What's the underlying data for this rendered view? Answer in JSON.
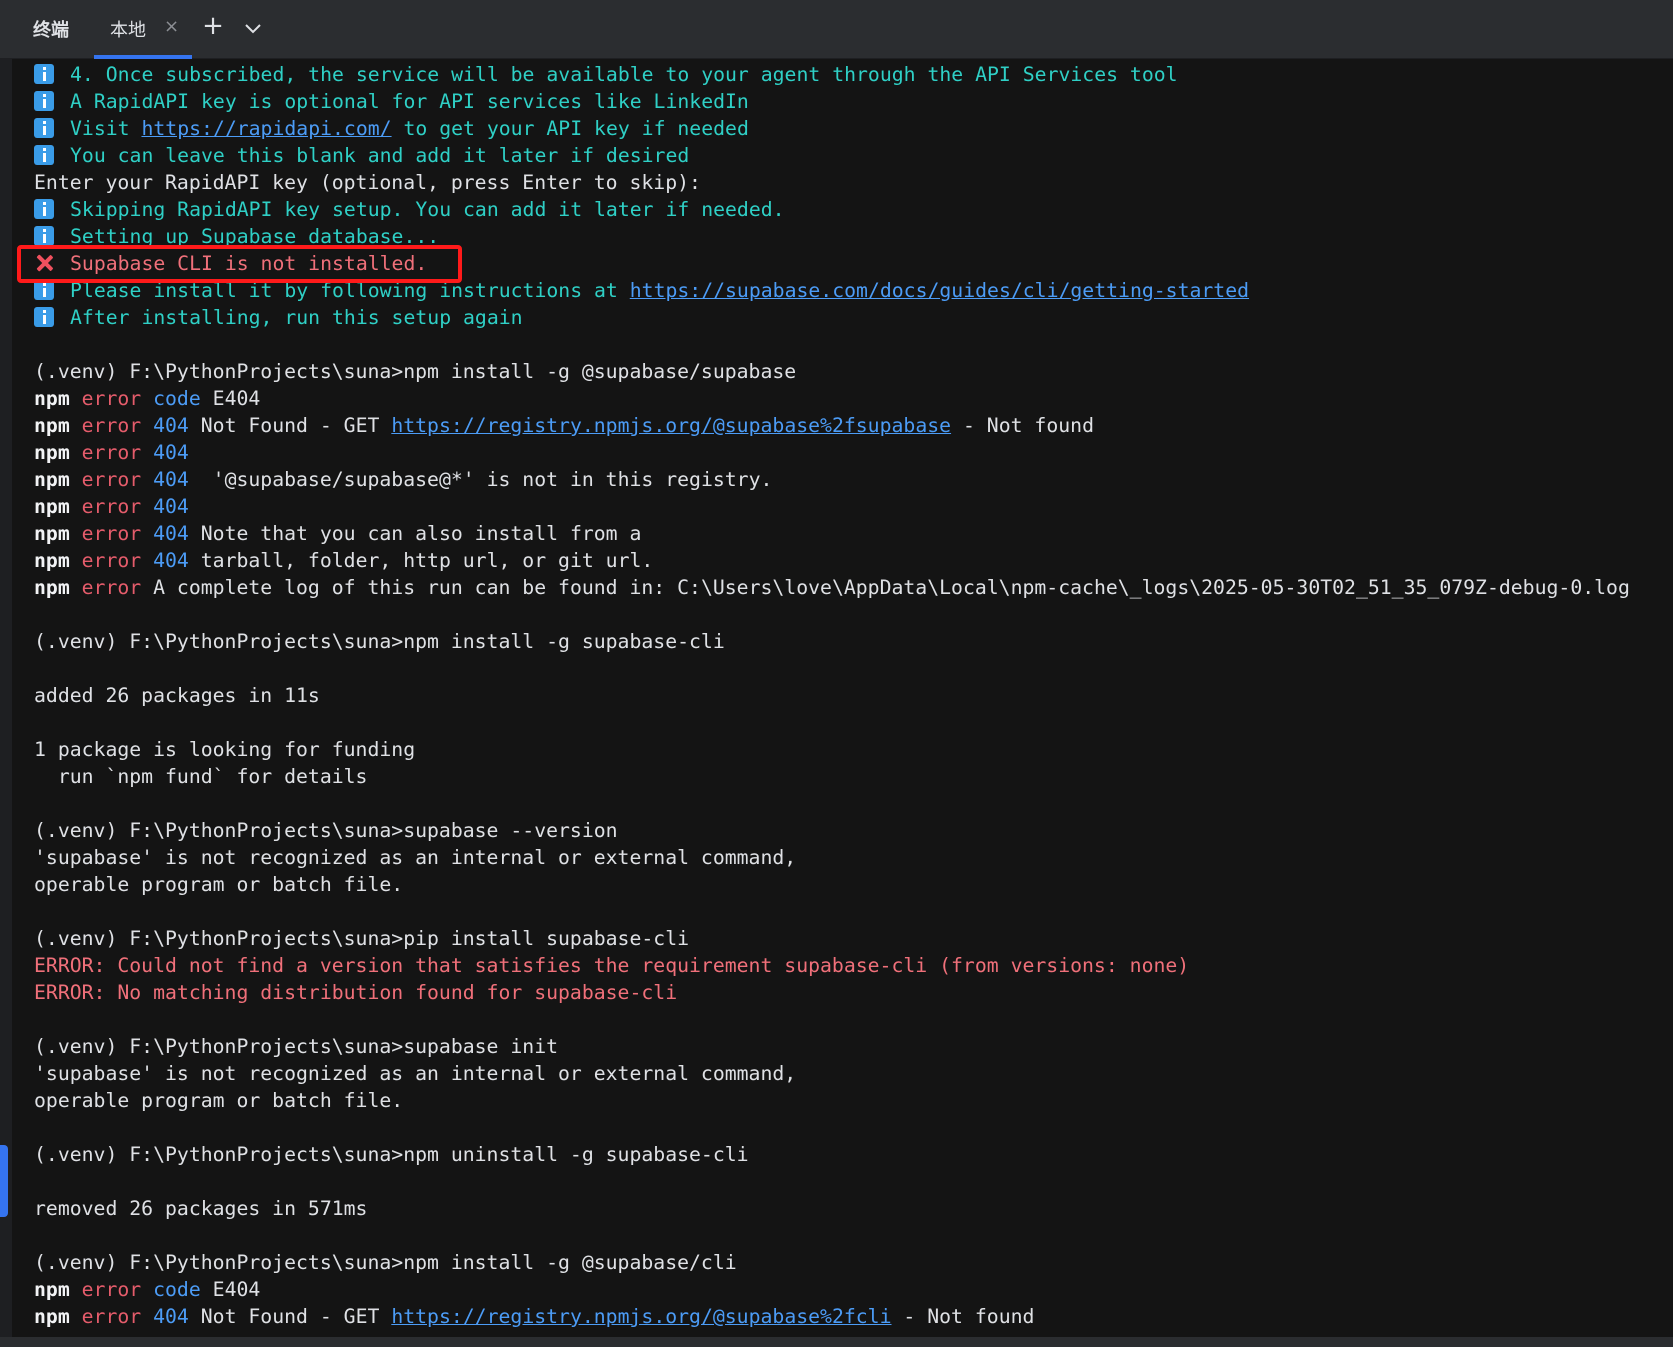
{
  "window": {
    "tool_title": "终端",
    "tab_label": "本地",
    "tab_close": "×",
    "new_tab": "+"
  },
  "colors": {
    "background": "#141414",
    "tab_bar": "#2b2d30",
    "accent": "#3574f0",
    "info_text": "#2fd0c6",
    "error_text": "#f0707a",
    "link": "#4c9cf6",
    "highlight_box": "#ff1a1a"
  },
  "terminal": {
    "lines": [
      {
        "icon": "info",
        "segments": [
          {
            "t": "4. Once subscribed, the service will be available to your agent through the API Services tool",
            "c": "info"
          }
        ]
      },
      {
        "icon": "info",
        "segments": [
          {
            "t": "A RapidAPI key is optional for API services like LinkedIn",
            "c": "info"
          }
        ]
      },
      {
        "icon": "info",
        "segments": [
          {
            "t": "Visit ",
            "c": "info"
          },
          {
            "t": "https://rapidapi.com/",
            "c": "link"
          },
          {
            "t": " to get your API key if needed",
            "c": "info"
          }
        ]
      },
      {
        "icon": "info",
        "segments": [
          {
            "t": "You can leave this blank and add it later if desired",
            "c": "info"
          }
        ]
      },
      {
        "segments": [
          {
            "t": "Enter your RapidAPI key (optional, press Enter to skip):",
            "c": "default"
          }
        ]
      },
      {
        "icon": "info",
        "segments": [
          {
            "t": "Skipping RapidAPI key setup. You can add it later if needed.",
            "c": "info"
          }
        ]
      },
      {
        "icon": "info",
        "segments": [
          {
            "t": "Setting up Supabase database...",
            "c": "info"
          }
        ]
      },
      {
        "icon": "error",
        "segments": [
          {
            "t": "Supabase CLI is not installed.",
            "c": "errmsg"
          }
        ]
      },
      {
        "icon": "info",
        "segments": [
          {
            "t": "Please install it by following instructions at ",
            "c": "info"
          },
          {
            "t": "https://supabase.com/docs/guides/cli/getting-started",
            "c": "link"
          }
        ]
      },
      {
        "icon": "info",
        "segments": [
          {
            "t": "After installing, run this setup again",
            "c": "info"
          }
        ]
      },
      {
        "segments": []
      },
      {
        "segments": [
          {
            "t": "(.venv) F:\\PythonProjects\\suna>npm install -g @supabase/supabase",
            "c": "default"
          }
        ]
      },
      {
        "segments": [
          {
            "t": "npm",
            "c": "npm"
          },
          {
            "t": " error",
            "c": "errword"
          },
          {
            "t": " code",
            "c": "code"
          },
          {
            "t": " E404",
            "c": "default"
          }
        ]
      },
      {
        "segments": [
          {
            "t": "npm",
            "c": "npm"
          },
          {
            "t": " error",
            "c": "errword"
          },
          {
            "t": " 404",
            "c": "code"
          },
          {
            "t": " Not Found - GET ",
            "c": "default"
          },
          {
            "t": "https://registry.npmjs.org/@supabase%2fsupabase",
            "c": "link"
          },
          {
            "t": " - Not found",
            "c": "default"
          }
        ]
      },
      {
        "segments": [
          {
            "t": "npm",
            "c": "npm"
          },
          {
            "t": " error",
            "c": "errword"
          },
          {
            "t": " 404",
            "c": "code"
          }
        ]
      },
      {
        "segments": [
          {
            "t": "npm",
            "c": "npm"
          },
          {
            "t": " error",
            "c": "errword"
          },
          {
            "t": " 404",
            "c": "code"
          },
          {
            "t": "  '@supabase/supabase@*' is not in this registry.",
            "c": "default"
          }
        ]
      },
      {
        "segments": [
          {
            "t": "npm",
            "c": "npm"
          },
          {
            "t": " error",
            "c": "errword"
          },
          {
            "t": " 404",
            "c": "code"
          }
        ]
      },
      {
        "segments": [
          {
            "t": "npm",
            "c": "npm"
          },
          {
            "t": " error",
            "c": "errword"
          },
          {
            "t": " 404",
            "c": "code"
          },
          {
            "t": " Note that you can also install from a",
            "c": "default"
          }
        ]
      },
      {
        "segments": [
          {
            "t": "npm",
            "c": "npm"
          },
          {
            "t": " error",
            "c": "errword"
          },
          {
            "t": " 404",
            "c": "code"
          },
          {
            "t": " tarball, folder, http url, or git url.",
            "c": "default"
          }
        ]
      },
      {
        "segments": [
          {
            "t": "npm",
            "c": "npm"
          },
          {
            "t": " error",
            "c": "errword"
          },
          {
            "t": " A complete log of this run can be found in: C:\\Users\\love\\AppData\\Local\\npm-cache\\_logs\\2025-05-30T02_51_35_079Z-debug-0.log",
            "c": "default"
          }
        ]
      },
      {
        "segments": []
      },
      {
        "segments": [
          {
            "t": "(.venv) F:\\PythonProjects\\suna>npm install -g supabase-cli",
            "c": "default"
          }
        ]
      },
      {
        "segments": []
      },
      {
        "segments": [
          {
            "t": "added 26 packages in 11s",
            "c": "default"
          }
        ]
      },
      {
        "segments": []
      },
      {
        "segments": [
          {
            "t": "1 package is looking for funding",
            "c": "default"
          }
        ]
      },
      {
        "segments": [
          {
            "t": "  run `npm fund` for details",
            "c": "default"
          }
        ]
      },
      {
        "segments": []
      },
      {
        "segments": [
          {
            "t": "(.venv) F:\\PythonProjects\\suna>supabase --version",
            "c": "default"
          }
        ]
      },
      {
        "segments": [
          {
            "t": "'supabase' is not recognized as an internal or external command,",
            "c": "default"
          }
        ]
      },
      {
        "segments": [
          {
            "t": "operable program or batch file.",
            "c": "default"
          }
        ]
      },
      {
        "segments": []
      },
      {
        "segments": [
          {
            "t": "(.venv) F:\\PythonProjects\\suna>pip install supabase-cli",
            "c": "default"
          }
        ]
      },
      {
        "segments": [
          {
            "t": "ERROR: Could not find a version that satisfies the requirement supabase-cli (from versions: none)",
            "c": "pip-error"
          }
        ]
      },
      {
        "segments": [
          {
            "t": "ERROR: No matching distribution found for supabase-cli",
            "c": "pip-error"
          }
        ]
      },
      {
        "segments": []
      },
      {
        "segments": [
          {
            "t": "(.venv) F:\\PythonProjects\\suna>supabase init",
            "c": "default"
          }
        ]
      },
      {
        "segments": [
          {
            "t": "'supabase' is not recognized as an internal or external command,",
            "c": "default"
          }
        ]
      },
      {
        "segments": [
          {
            "t": "operable program or batch file.",
            "c": "default"
          }
        ]
      },
      {
        "segments": []
      },
      {
        "segments": [
          {
            "t": "(.venv) F:\\PythonProjects\\suna>npm uninstall -g supabase-cli",
            "c": "default"
          }
        ]
      },
      {
        "segments": []
      },
      {
        "segments": [
          {
            "t": "removed 26 packages in 571ms",
            "c": "default"
          }
        ]
      },
      {
        "segments": []
      },
      {
        "segments": [
          {
            "t": "(.venv) F:\\PythonProjects\\suna>npm install -g @supabase/cli",
            "c": "default"
          }
        ]
      },
      {
        "segments": [
          {
            "t": "npm",
            "c": "npm"
          },
          {
            "t": " error",
            "c": "errword"
          },
          {
            "t": " code",
            "c": "code"
          },
          {
            "t": " E404",
            "c": "default"
          }
        ]
      },
      {
        "segments": [
          {
            "t": "npm",
            "c": "npm"
          },
          {
            "t": " error",
            "c": "errword"
          },
          {
            "t": " 404",
            "c": "code"
          },
          {
            "t": " Not Found - GET ",
            "c": "default"
          },
          {
            "t": "https://registry.npmjs.org/@supabase%2fcli",
            "c": "link"
          },
          {
            "t": " - Not found",
            "c": "default"
          }
        ]
      }
    ]
  }
}
